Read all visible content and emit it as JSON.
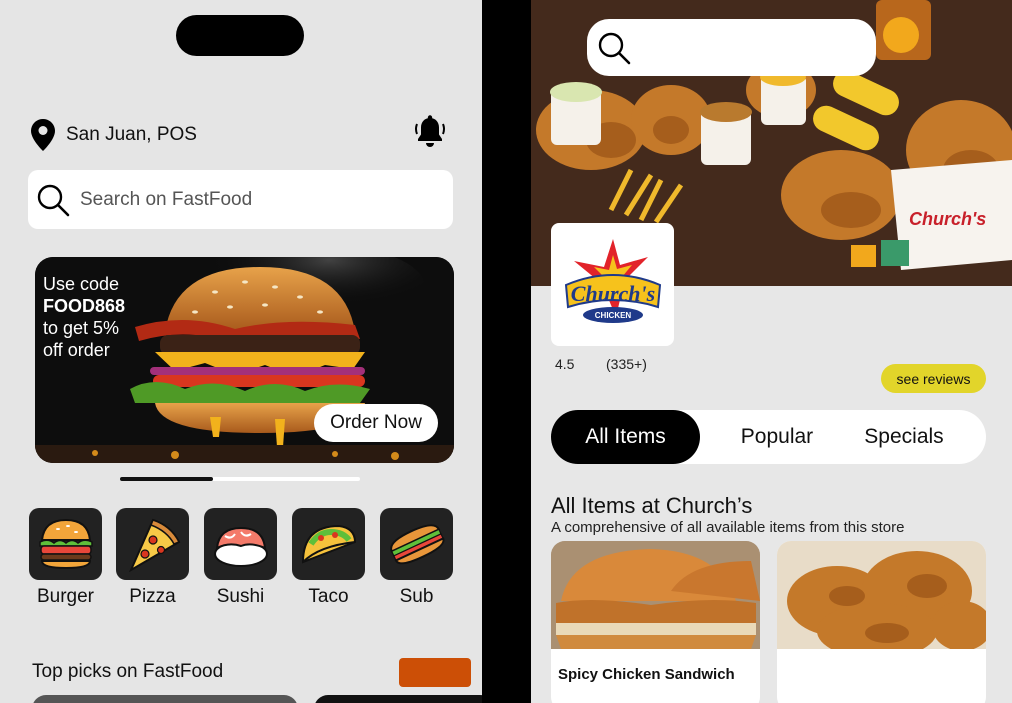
{
  "left": {
    "location": "San Juan, POS",
    "search": {
      "placeholder": "Search on FastFood"
    },
    "promo": {
      "line1": "Use code",
      "code": "FOOD868",
      "line2": "to get 5%",
      "line3": "off order",
      "button": "Order Now"
    },
    "categories": [
      {
        "label": "Burger",
        "icon": "burger-icon"
      },
      {
        "label": "Pizza",
        "icon": "pizza-icon"
      },
      {
        "label": "Sushi",
        "icon": "sushi-icon"
      },
      {
        "label": "Taco",
        "icon": "taco-icon"
      },
      {
        "label": "Sub",
        "icon": "sub-sandwich-icon"
      }
    ],
    "top_picks": "Top picks on FastFood",
    "colors": {
      "accent": "#cc4f06"
    }
  },
  "right": {
    "brand_logo_text": "Church's",
    "brand_logo_sub": "CHICKEN",
    "rating": "4.5",
    "reviews_count": "(335+)",
    "see_reviews": "see reviews",
    "tabs": [
      "All Items",
      "Popular",
      "Specials"
    ],
    "active_tab": "All Items",
    "section_title": "All Items at Church’s",
    "section_subtitle": "A comprehensive of all available items from this store",
    "items": [
      {
        "name": "Spicy Chicken Sandwich"
      },
      {
        "name": ""
      }
    ],
    "colors": {
      "see_reviews_bg": "#e2d52a"
    }
  }
}
